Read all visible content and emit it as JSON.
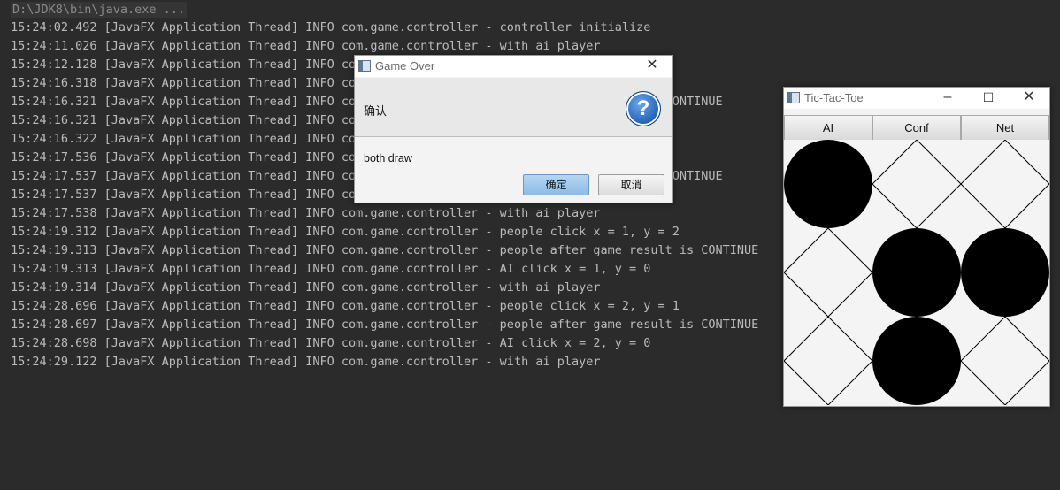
{
  "console": {
    "command": "D:\\JDK8\\bin\\java.exe ...",
    "lines": [
      "15:24:02.492 [JavaFX Application Thread] INFO com.game.controller - controller initialize",
      "15:24:11.026 [JavaFX Application Thread] INFO com.game.controller - with ai player",
      "15:24:12.128 [JavaFX Application Thread] INFO com",
      "15:24:16.318 [JavaFX Application Thread] INFO com",
      "15:24:16.321 [JavaFX Application Thread] INFO com                                       is CONTINUE",
      "15:24:16.321 [JavaFX Application Thread] INFO com",
      "15:24:16.322 [JavaFX Application Thread] INFO com",
      "15:24:17.536 [JavaFX Application Thread] INFO com",
      "15:24:17.537 [JavaFX Application Thread] INFO com                                       is CONTINUE",
      "15:24:17.537 [JavaFX Application Thread] INFO com",
      "15:24:17.538 [JavaFX Application Thread] INFO com.game.controller - with ai player",
      "15:24:19.312 [JavaFX Application Thread] INFO com.game.controller - people click x = 1, y = 2",
      "15:24:19.313 [JavaFX Application Thread] INFO com.game.controller - people after game result is CONTINUE",
      "15:24:19.313 [JavaFX Application Thread] INFO com.game.controller - AI click x = 1, y = 0",
      "15:24:19.314 [JavaFX Application Thread] INFO com.game.controller - with ai player",
      "15:24:28.696 [JavaFX Application Thread] INFO com.game.controller - people click x = 2, y = 1",
      "15:24:28.697 [JavaFX Application Thread] INFO com.game.controller - people after game result is CONTINUE",
      "15:24:28.698 [JavaFX Application Thread] INFO com.game.controller - AI click x = 2, y = 0",
      "15:24:29.122 [JavaFX Application Thread] INFO com.game.controller - with ai player"
    ]
  },
  "dialog": {
    "title": "Game Over",
    "header": "确认",
    "content": "both draw",
    "ok_label": "确定",
    "cancel_label": "取消",
    "icon": "question-icon"
  },
  "game_window": {
    "title": "Tic-Tac-Toe",
    "buttons": [
      "AI",
      "Conf",
      "Net"
    ],
    "board": [
      [
        "O",
        "X",
        "X"
      ],
      [
        "X",
        "O",
        "O"
      ],
      [
        "X",
        "O",
        "X"
      ]
    ]
  },
  "colors": {
    "console_bg": "#2b2b2b",
    "console_text": "#bbbbbb",
    "primary_button": "#8cbbe6",
    "question_icon": "#1f5fb8"
  }
}
